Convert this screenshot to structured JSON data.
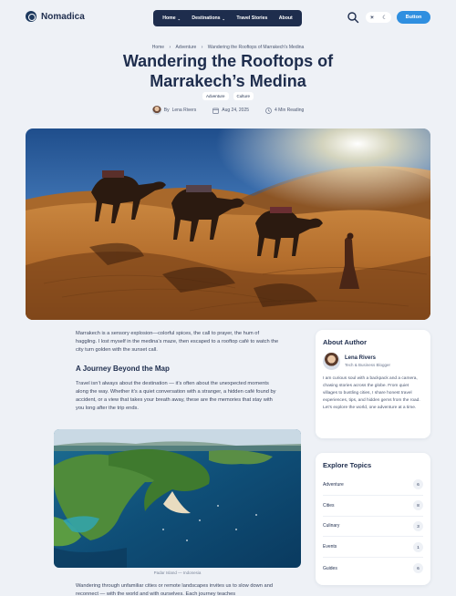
{
  "brand": {
    "name": "Nomadica"
  },
  "nav": {
    "items": [
      {
        "label": "Home",
        "dropdown": true
      },
      {
        "label": "Destinations",
        "dropdown": true
      },
      {
        "label": "Travel Stories",
        "dropdown": false
      },
      {
        "label": "About",
        "dropdown": false
      }
    ]
  },
  "header": {
    "cta_label": "Button",
    "theme_light_icon": "☀",
    "theme_dark_icon": "☾"
  },
  "breadcrumb": [
    "Home",
    "Adventure",
    "Wandering the Rooftops of Marrakech's Medina"
  ],
  "breadcrumb_sep": "›",
  "post": {
    "title": "Wandering the Rooftops of Marrakech’s Medina",
    "tags": [
      "Adventure",
      "Culture"
    ],
    "author_prefix": "By",
    "author": "Lena Rivers",
    "date": "Aug 24, 2025",
    "reading": "4 Min Reading",
    "intro": "Marrakech is a sensory explosion—colorful spices, the call to prayer, the hum of haggling. I lost myself in the medina’s maze, then escaped to a rooftop café to watch the city turn golden with the sunset call.",
    "section_heading": "A Journey Beyond the Map",
    "section_text": "Travel isn’t always about the destination — it’s often about the unexpected moments along the way. Whether it’s a quiet conversation with a stranger, a hidden café found by accident, or a view that takes your breath away, these are the memories that stay with you long after the trip ends.",
    "photo_caption": "Padar Island — Indonesia",
    "tail_text": "Wandering through unfamiliar cities or remote landscapes invites us to slow down and reconnect — with the world and with ourselves. Each journey teaches"
  },
  "about": {
    "title": "About Author",
    "name": "Lena Rivers",
    "role": "Tech & Business Blogger",
    "bio": "I am curious soul with a backpack and a camera, chasing stories across the globe. From quiet villages to bustling cities, I share honest travel experiences, tips, and hidden gems from the road. Let’s explore the world, one adventure at a time."
  },
  "topics": {
    "title": "Explore Topics",
    "items": [
      {
        "label": "Adventure",
        "count": "6"
      },
      {
        "label": "Cities",
        "count": "8"
      },
      {
        "label": "Culinary",
        "count": "3"
      },
      {
        "label": "Events",
        "count": "1"
      },
      {
        "label": "Guides",
        "count": "6"
      }
    ]
  },
  "colors": {
    "navy": "#1e2d4d",
    "accent": "#2f8fe0",
    "background": "#eef1f6"
  }
}
